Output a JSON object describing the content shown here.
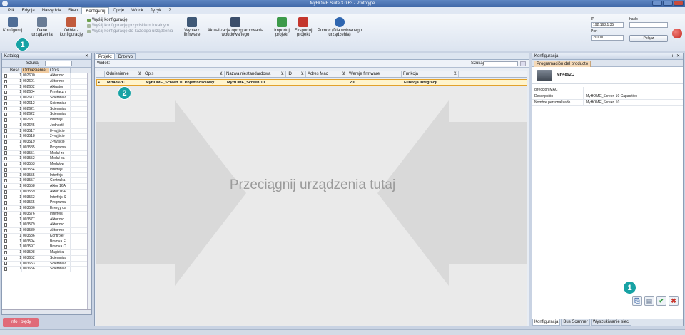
{
  "window": {
    "title": "MyHOME Suite 3.0.63 - Prototype"
  },
  "menu": {
    "items": [
      "Plik",
      "Edycja",
      "Narzędzia",
      "Skan",
      "Konfiguruj",
      "Opcje",
      "Widok",
      "Język",
      "?"
    ],
    "active": "Konfiguruj"
  },
  "ribbon": {
    "configure": "Konfiguruj",
    "device_data": "Dane urządzenia",
    "receive_config": "Odbierz konfigurację",
    "send_config": "Wyślij konfigurację",
    "send_config_local": "Wyślij konfigurację przyciskiem lokalnym",
    "send_config_each": "Wyślij konfigurację do każdego urządzenia",
    "choose_firmware": "Wybierz firmware",
    "update_firmware": "Aktualizacja oprogramowania wbudowanego",
    "import_project": "Importuj projekt",
    "export_project": "Eksportuj projekt",
    "help": "Pomoc (Dla wybranego urządzenia)"
  },
  "connection": {
    "ip_label": "IP",
    "ip_value": "192.168.1.35",
    "password_label": "hasło",
    "port_label": "Port",
    "port_value": "20000",
    "connect_button": "Połącz"
  },
  "catalog": {
    "title": "Katalog",
    "search_label": "Szukaj",
    "columns": [
      "Bosc",
      "Odniesienie",
      "Opis"
    ],
    "rows": [
      [
        "1",
        "002600",
        "Aktor mo"
      ],
      [
        "1",
        "002601",
        "Aktor mo"
      ],
      [
        "1",
        "002602",
        "Aktuator"
      ],
      [
        "1",
        "002604",
        "Przełączn"
      ],
      [
        "1",
        "002611",
        "Ściemniac"
      ],
      [
        "1",
        "002612",
        "Ściemniac"
      ],
      [
        "1",
        "002621",
        "Ściemniac"
      ],
      [
        "1",
        "002622",
        "Ściemniac"
      ],
      [
        "1",
        "002631",
        "Interfejs"
      ],
      [
        "1",
        "002645",
        "Jednostk"
      ],
      [
        "1",
        "003517",
        "8-wyjścio"
      ],
      [
        "1",
        "003518",
        "2-wyjścio"
      ],
      [
        "1",
        "003519",
        "2-wyjścio"
      ],
      [
        "1",
        "003535",
        "Programa"
      ],
      [
        "1",
        "003551",
        "Moduł ze"
      ],
      [
        "1",
        "003552",
        "Moduł pa"
      ],
      [
        "1",
        "003553",
        "Modułow"
      ],
      [
        "1",
        "003554",
        "Interfejs"
      ],
      [
        "1",
        "003555",
        "Interfejs"
      ],
      [
        "1",
        "003557",
        "Centralka"
      ],
      [
        "1",
        "003558",
        "Aktor 16A"
      ],
      [
        "1",
        "003559",
        "Aktor 16A"
      ],
      [
        "1",
        "003562",
        "Interfejs S"
      ],
      [
        "1",
        "003565",
        "Programa"
      ],
      [
        "1",
        "003566",
        "Energy da"
      ],
      [
        "1",
        "003576",
        "Interfejs"
      ],
      [
        "1",
        "003577",
        "Aktor mo"
      ],
      [
        "1",
        "003579",
        "Aktor mo"
      ],
      [
        "1",
        "003580",
        "Aktor mo"
      ],
      [
        "1",
        "003586",
        "Kontroler"
      ],
      [
        "1",
        "003594",
        "Bramka E"
      ],
      [
        "1",
        "003597",
        "Bramka C"
      ],
      [
        "1",
        "003598",
        "Magistral"
      ],
      [
        "1",
        "003652",
        "Ściemniac"
      ],
      [
        "1",
        "003653",
        "Ściemniac"
      ],
      [
        "1",
        "003656",
        "Ściemniac"
      ]
    ]
  },
  "info_button": "Info i błędy",
  "project": {
    "tabs": [
      "Projekt",
      "Drzewo"
    ],
    "view_label": "Widok:",
    "search_label": "Szukaj",
    "columns": [
      "Odniesienie",
      "Opis",
      "Nazwa niestandardowa",
      "ID",
      "Adres Mac",
      "Wersje firmware",
      "Funkcja"
    ],
    "device": {
      "ref": "MH4892C",
      "desc": "MyHOME_Screen 10 Pojemnościowy",
      "name": "MyHOME_Screen 10",
      "id": "",
      "mac": "",
      "firmware": "2.0",
      "function": "Funkcja integracji"
    },
    "drop_text": "Przeciągnij urządzenia tutaj"
  },
  "config": {
    "title": "Konfiguracja",
    "tab": "Programación del producto",
    "product": "MH4892C",
    "props": [
      [
        "dirección MAC",
        ""
      ],
      [
        "Descripción",
        "MyHOME_Screen 10 Capacitivo"
      ],
      [
        "Nombre personalizado",
        "MyHOME_Screen 10"
      ]
    ],
    "bottom_tabs": [
      "Konfiguracja",
      "Bus Scanner",
      "Wyszukiwanie sieci"
    ]
  },
  "badges": {
    "one": "1",
    "two": "2"
  },
  "colors": {
    "badge": "#17a2a4",
    "accent": "#e2a12b"
  }
}
